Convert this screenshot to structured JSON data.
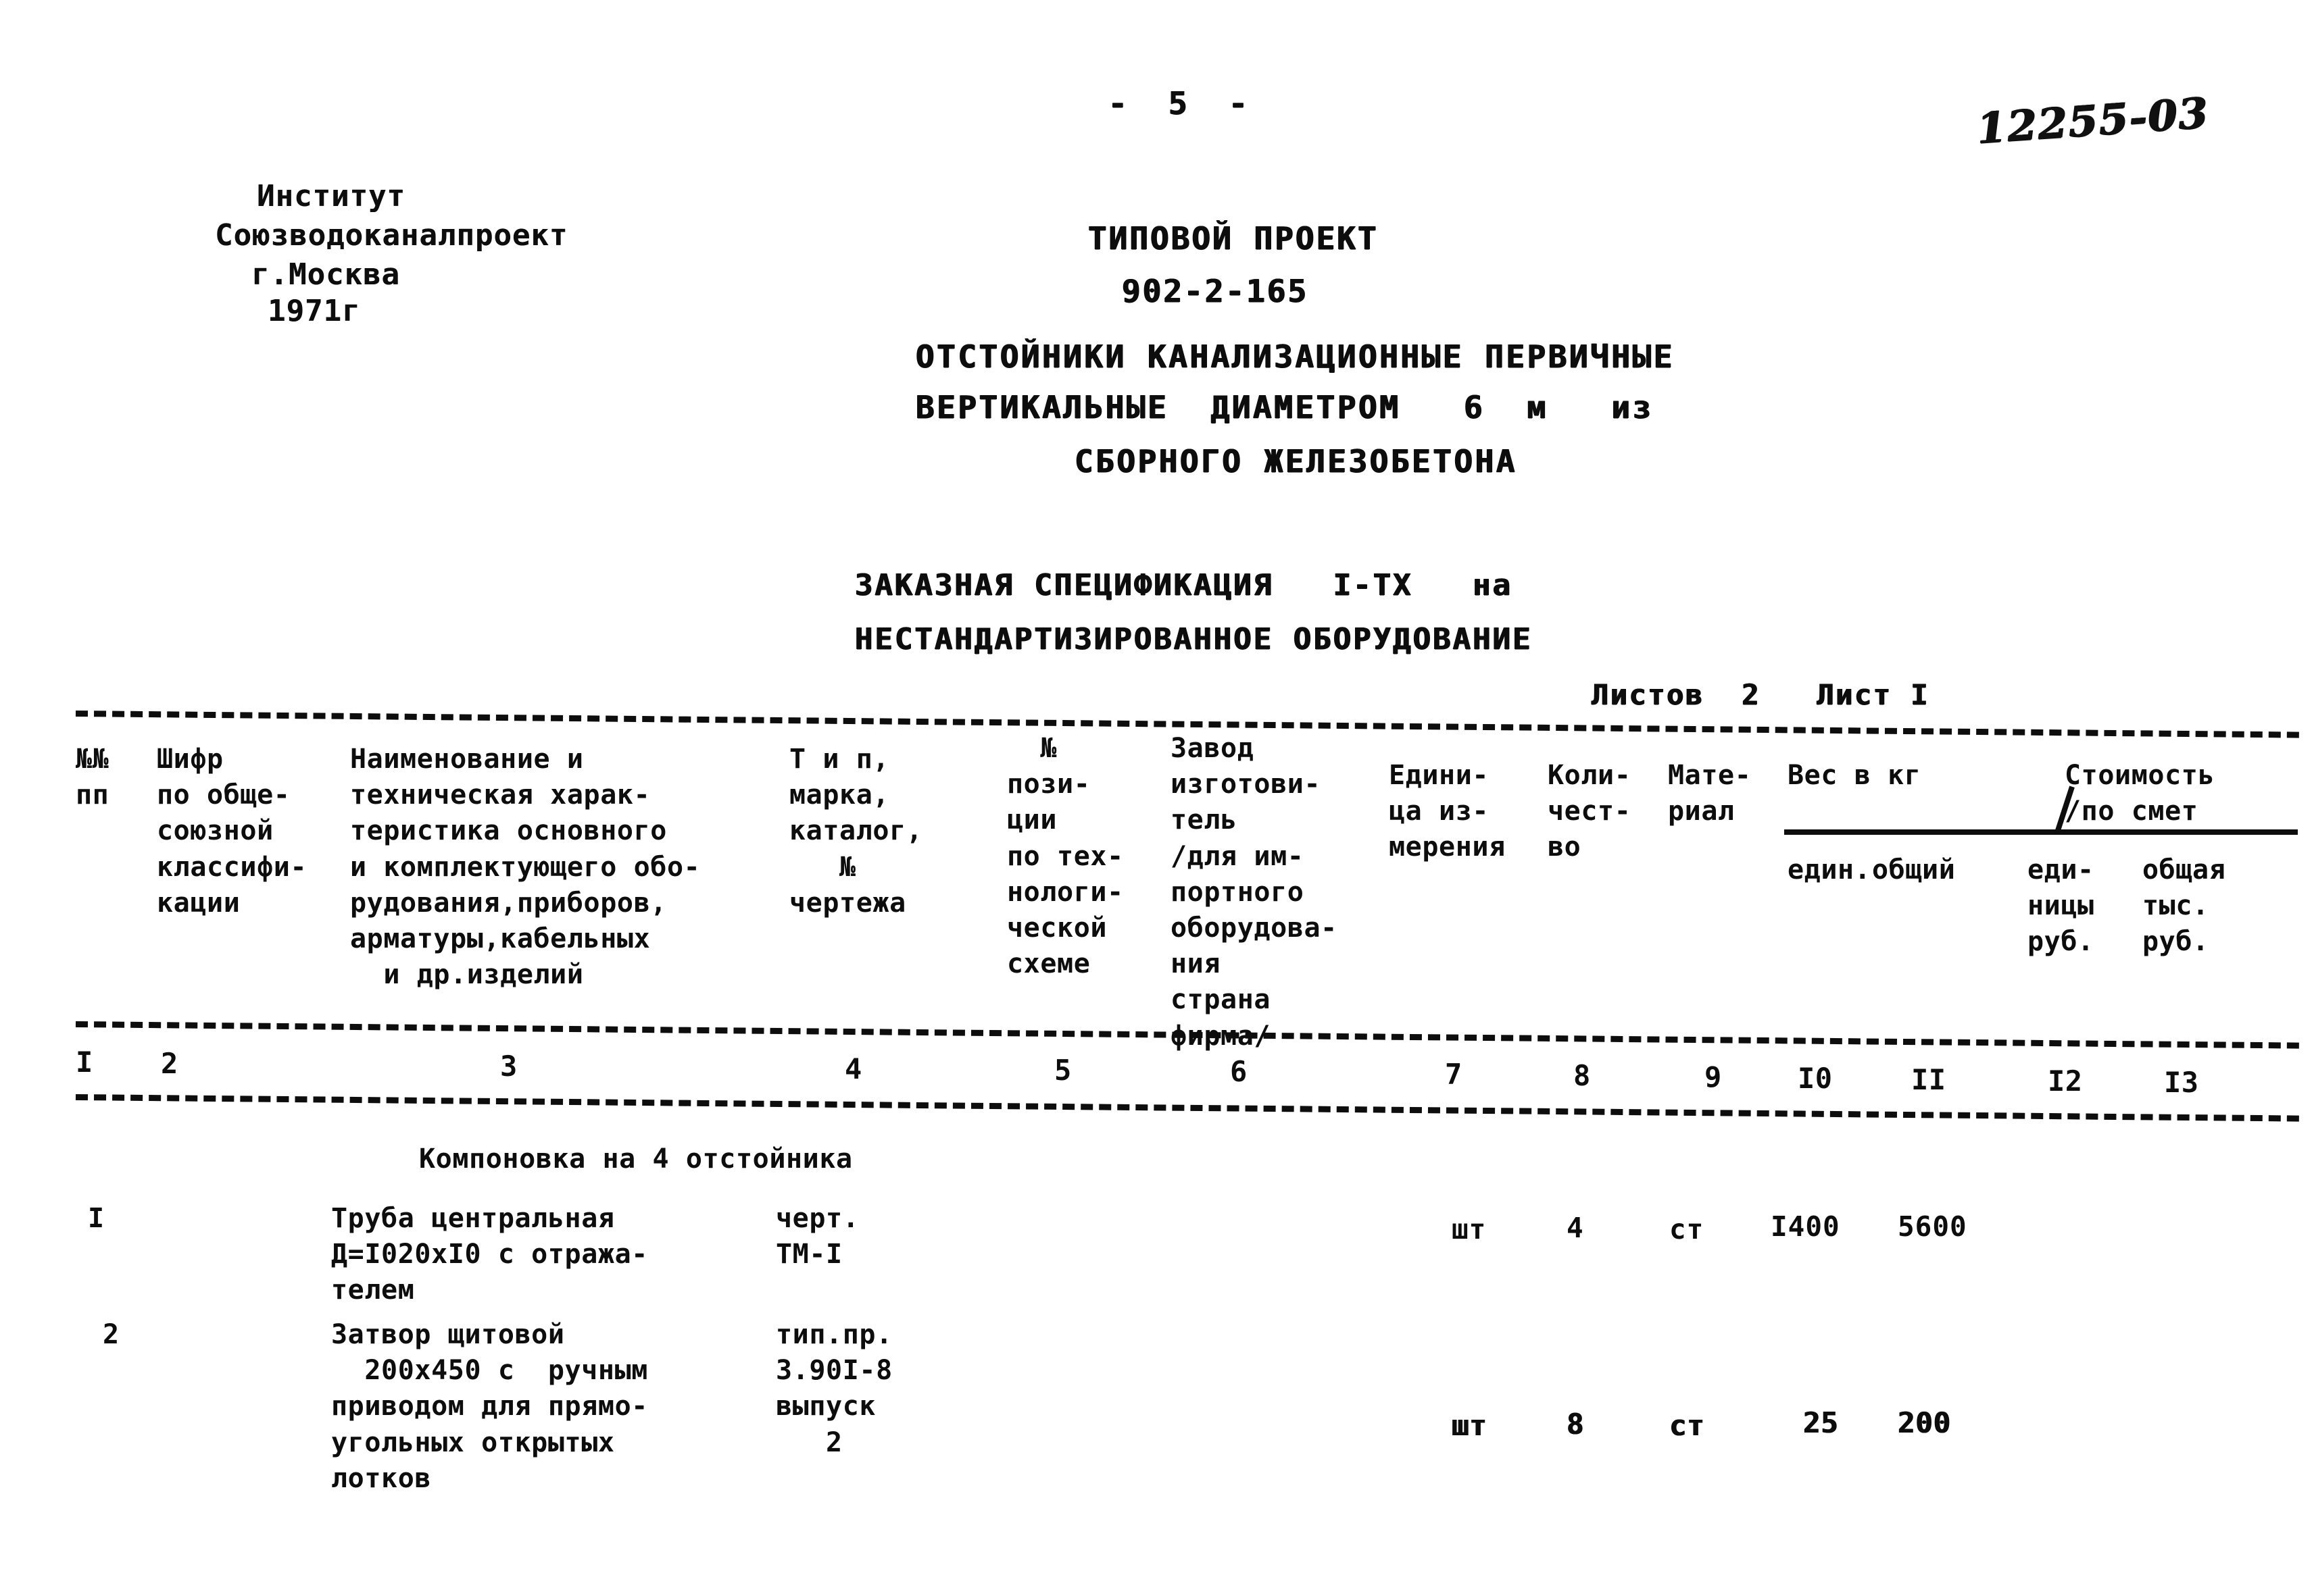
{
  "page": {
    "number_marker": "-  5  -",
    "archive_code": "12255-03"
  },
  "institute": {
    "line1": "Институт",
    "line2": "Союзводоканалпроект",
    "line3": "г.Москва",
    "line4": "1971г"
  },
  "project": {
    "kind": "ТИПОВОЙ ПРОЕКТ",
    "code": "902-2-165",
    "title_line1": "ОТСТОЙНИКИ КАНАЛИЗАЦИОННЫЕ ПЕРВИЧНЫЕ",
    "title_line2": "ВЕРТИКАЛЬНЫЕ  ДИАМЕТРОМ   6  м   из",
    "title_line3": "СБОРНОГО ЖЕЛЕЗОБЕТОНА"
  },
  "spec": {
    "heading_line1": "ЗАКАЗНАЯ СПЕЦИФИКАЦИЯ   I-TX   на",
    "heading_line2": "НЕСТАНДАРТИЗИРОВАННОЕ ОБОРУДОВАНИЕ",
    "sheets": "Листов  2   Лист I"
  },
  "table": {
    "headers": {
      "col1": "№№\nпп",
      "col2": "Шифр\nпо обще-\nсоюзной\nклассифи-\nкации",
      "col3": "Наименование и\nтехническая харак-\nтеристика основного\nи комплектующего обо-\nрудования,приборов,\nарматуры,кабельных\n  и др.изделий",
      "col4": "Т и п,\nмарка,\nкаталог,\n   №\nчертежа",
      "col5": "  №\nпози-\nции\nпо тех-\nнологи-\nческой\nсхеме",
      "col6": "Завод\nизготови-\nтель\n/для им-\nпортного\nоборудова-\nния\nстрана\nфирма/",
      "col7": "Едини-\nца из-\nмерения",
      "col8": "Коли-\nчест-\nво",
      "col9": "Мате-\nриал",
      "col10_group": "Вес в кг",
      "col10": "един.",
      "col11": "общий",
      "col12_group": "Стоимость\n/по смет",
      "col12": "еди-\nницы\nруб.",
      "col13": "общая\nтыс.\nруб."
    },
    "column_numbers": [
      "I",
      "2",
      "3",
      "4",
      "5",
      "6",
      "7",
      "8",
      "9",
      "I0",
      "II",
      "I2",
      "I3"
    ],
    "section_note": "Компоновка на 4 отстойника",
    "rows": [
      {
        "num": "I",
        "code": "",
        "name": "Труба центральная\nД=I020xI0 с отража-\nтелем",
        "type": "черт.\nТМ-I",
        "position": "",
        "factory": "",
        "unit": "шт",
        "qty": "4",
        "material": "ст",
        "weight_unit": "I400",
        "weight_total": "5600",
        "price_unit": "",
        "price_total": "",
        "bold_values": false
      },
      {
        "num": "2",
        "code": "",
        "name": "Затвор щитовой\n  200х450 с  ручным\nприводом для прямо-\nугольных открытых\nлотков",
        "type": "тип.пр.\n3.90I-8\nвыпуск\n   2",
        "position": "",
        "factory": "",
        "unit": "шт",
        "qty": "8",
        "material": "ст",
        "weight_unit": "25",
        "weight_total": "200",
        "price_unit": "",
        "price_total": "",
        "bold_values": true
      }
    ]
  }
}
